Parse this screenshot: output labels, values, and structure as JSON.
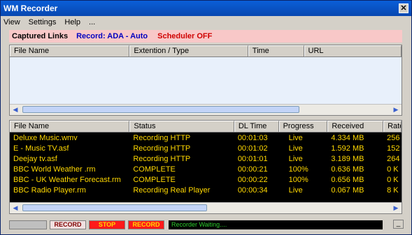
{
  "window": {
    "title": "WM Recorder",
    "close_glyph": "✕"
  },
  "menu": {
    "view": "View",
    "settings": "Settings",
    "help": "Help",
    "more": "..."
  },
  "banner": {
    "captured_links": "Captured Links",
    "record_mode": "Record: ADA - Auto",
    "scheduler": "Scheduler OFF"
  },
  "links_table": {
    "columns": [
      "File Name",
      "Extention / Type",
      "Time",
      "URL"
    ]
  },
  "downloads_table": {
    "columns": [
      "File Name",
      "Status",
      "DL Time",
      "Progress",
      "Received",
      "Rate"
    ],
    "rows": [
      [
        "Deluxe Music.wmv",
        "Recording HTTP",
        "00:01:03",
        "Live",
        "4.334 MB",
        "256"
      ],
      [
        "E - Music TV.asf",
        "Recording HTTP",
        "00:01:02",
        "Live",
        "1.592 MB",
        "152"
      ],
      [
        "Deejay tv.asf",
        "Recording HTTP",
        "00:01:01",
        "Live",
        "3.189 MB",
        "264"
      ],
      [
        "BBC World Weather .rm",
        "COMPLETE",
        "00:00:21",
        "100%",
        "0.636 MB",
        "0 K"
      ],
      [
        "BBC - UK Weather Forecast.rm",
        "COMPLETE",
        "00:00:22",
        "100%",
        "0.656 MB",
        "0 K"
      ],
      [
        "BBC Radio Player.rm",
        "Recording Real Player",
        "00:00:34",
        "Live",
        "0.067 MB",
        "8 K"
      ]
    ]
  },
  "controls": {
    "record_label": "RECORD",
    "stop_label": "STOP",
    "record_active_label": "RECORD",
    "status_text": "Recorder Waiting....",
    "minimize_glyph": "_"
  },
  "scroll": {
    "left_glyph": "◀",
    "right_glyph": "▶",
    "grip": "|||"
  }
}
